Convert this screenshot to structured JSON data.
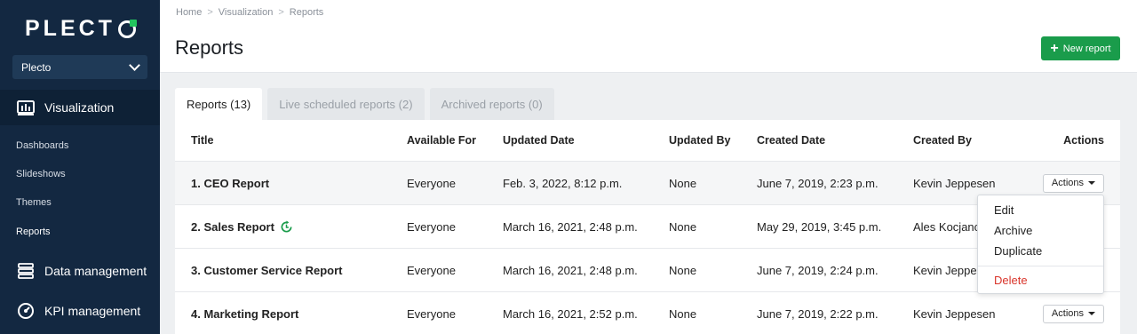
{
  "app": {
    "logo_text": "PLECT"
  },
  "sidebar": {
    "org_select": "Plecto",
    "sections": [
      {
        "label": "Visualization",
        "icon": "bar-chart-icon"
      },
      {
        "label": "Data management",
        "icon": "database-icon"
      },
      {
        "label": "KPI management",
        "icon": "gauge-icon"
      }
    ],
    "sub_items": [
      "Dashboards",
      "Slideshows",
      "Themes",
      "Reports"
    ]
  },
  "breadcrumb": [
    "Home",
    "Visualization",
    "Reports"
  ],
  "page": {
    "title": "Reports",
    "new_button": "New report"
  },
  "tabs": [
    "Reports (13)",
    "Live scheduled reports (2)",
    "Archived reports (0)"
  ],
  "table": {
    "columns": [
      "Title",
      "Available For",
      "Updated Date",
      "Updated By",
      "Created Date",
      "Created By",
      "Actions"
    ],
    "rows": [
      {
        "title": "1. CEO Report",
        "available": "Everyone",
        "updated": "Feb. 3, 2022, 8:12 p.m.",
        "updated_by": "None",
        "created": "June 7, 2019, 2:23 p.m.",
        "created_by": "Kevin Jeppesen",
        "action": "Actions"
      },
      {
        "title": "2. Sales Report",
        "available": "Everyone",
        "updated": "March 16, 2021, 2:48 p.m.",
        "updated_by": "None",
        "created": "May 29, 2019, 3:45 p.m.",
        "created_by": "Ales Kocjancic"
      },
      {
        "title": "3. Customer Service Report",
        "available": "Everyone",
        "updated": "March 16, 2021, 2:48 p.m.",
        "updated_by": "None",
        "created": "June 7, 2019, 2:24 p.m.",
        "created_by": "Kevin Jeppesen"
      },
      {
        "title": "4. Marketing Report",
        "available": "Everyone",
        "updated": "March 16, 2021, 2:52 p.m.",
        "updated_by": "None",
        "created": "June 7, 2019, 2:22 p.m.",
        "created_by": "Kevin Jeppesen",
        "action": "Actions"
      }
    ]
  },
  "dropdown": {
    "items": [
      "Edit",
      "Archive",
      "Duplicate"
    ],
    "danger": "Delete"
  },
  "colors": {
    "sidebar_bg": "#132841",
    "primary_green": "#1a9c4b",
    "danger_red": "#d9352b",
    "logo_accent": "#22c55e"
  }
}
